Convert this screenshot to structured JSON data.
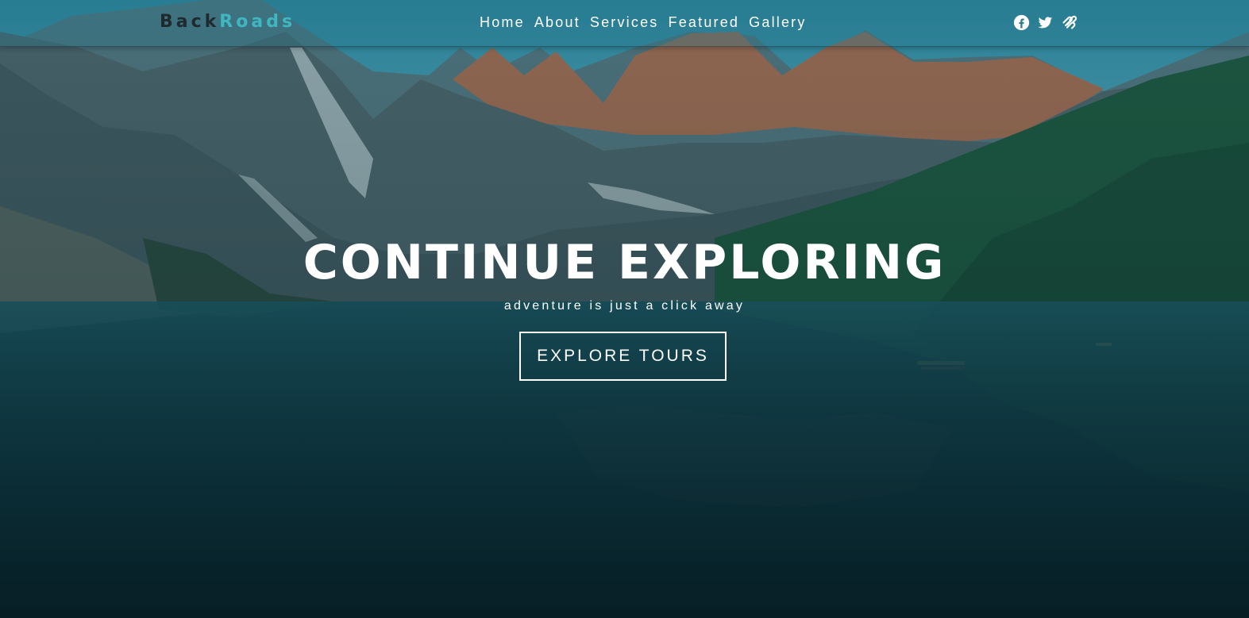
{
  "brand": {
    "name_part1": "Back",
    "name_part2": "Roads",
    "accent_color": "#3fb7c2"
  },
  "nav": {
    "links": [
      "Home",
      "About",
      "Services",
      "Featured",
      "Gallery"
    ]
  },
  "social": {
    "icons": [
      "facebook-icon",
      "twitter-icon",
      "squarespace-icon"
    ]
  },
  "banner": {
    "title": "CONTINUE EXPLORING",
    "subtitle": "adventure is just a click away",
    "button_label": "EXPLORE TOURS"
  }
}
